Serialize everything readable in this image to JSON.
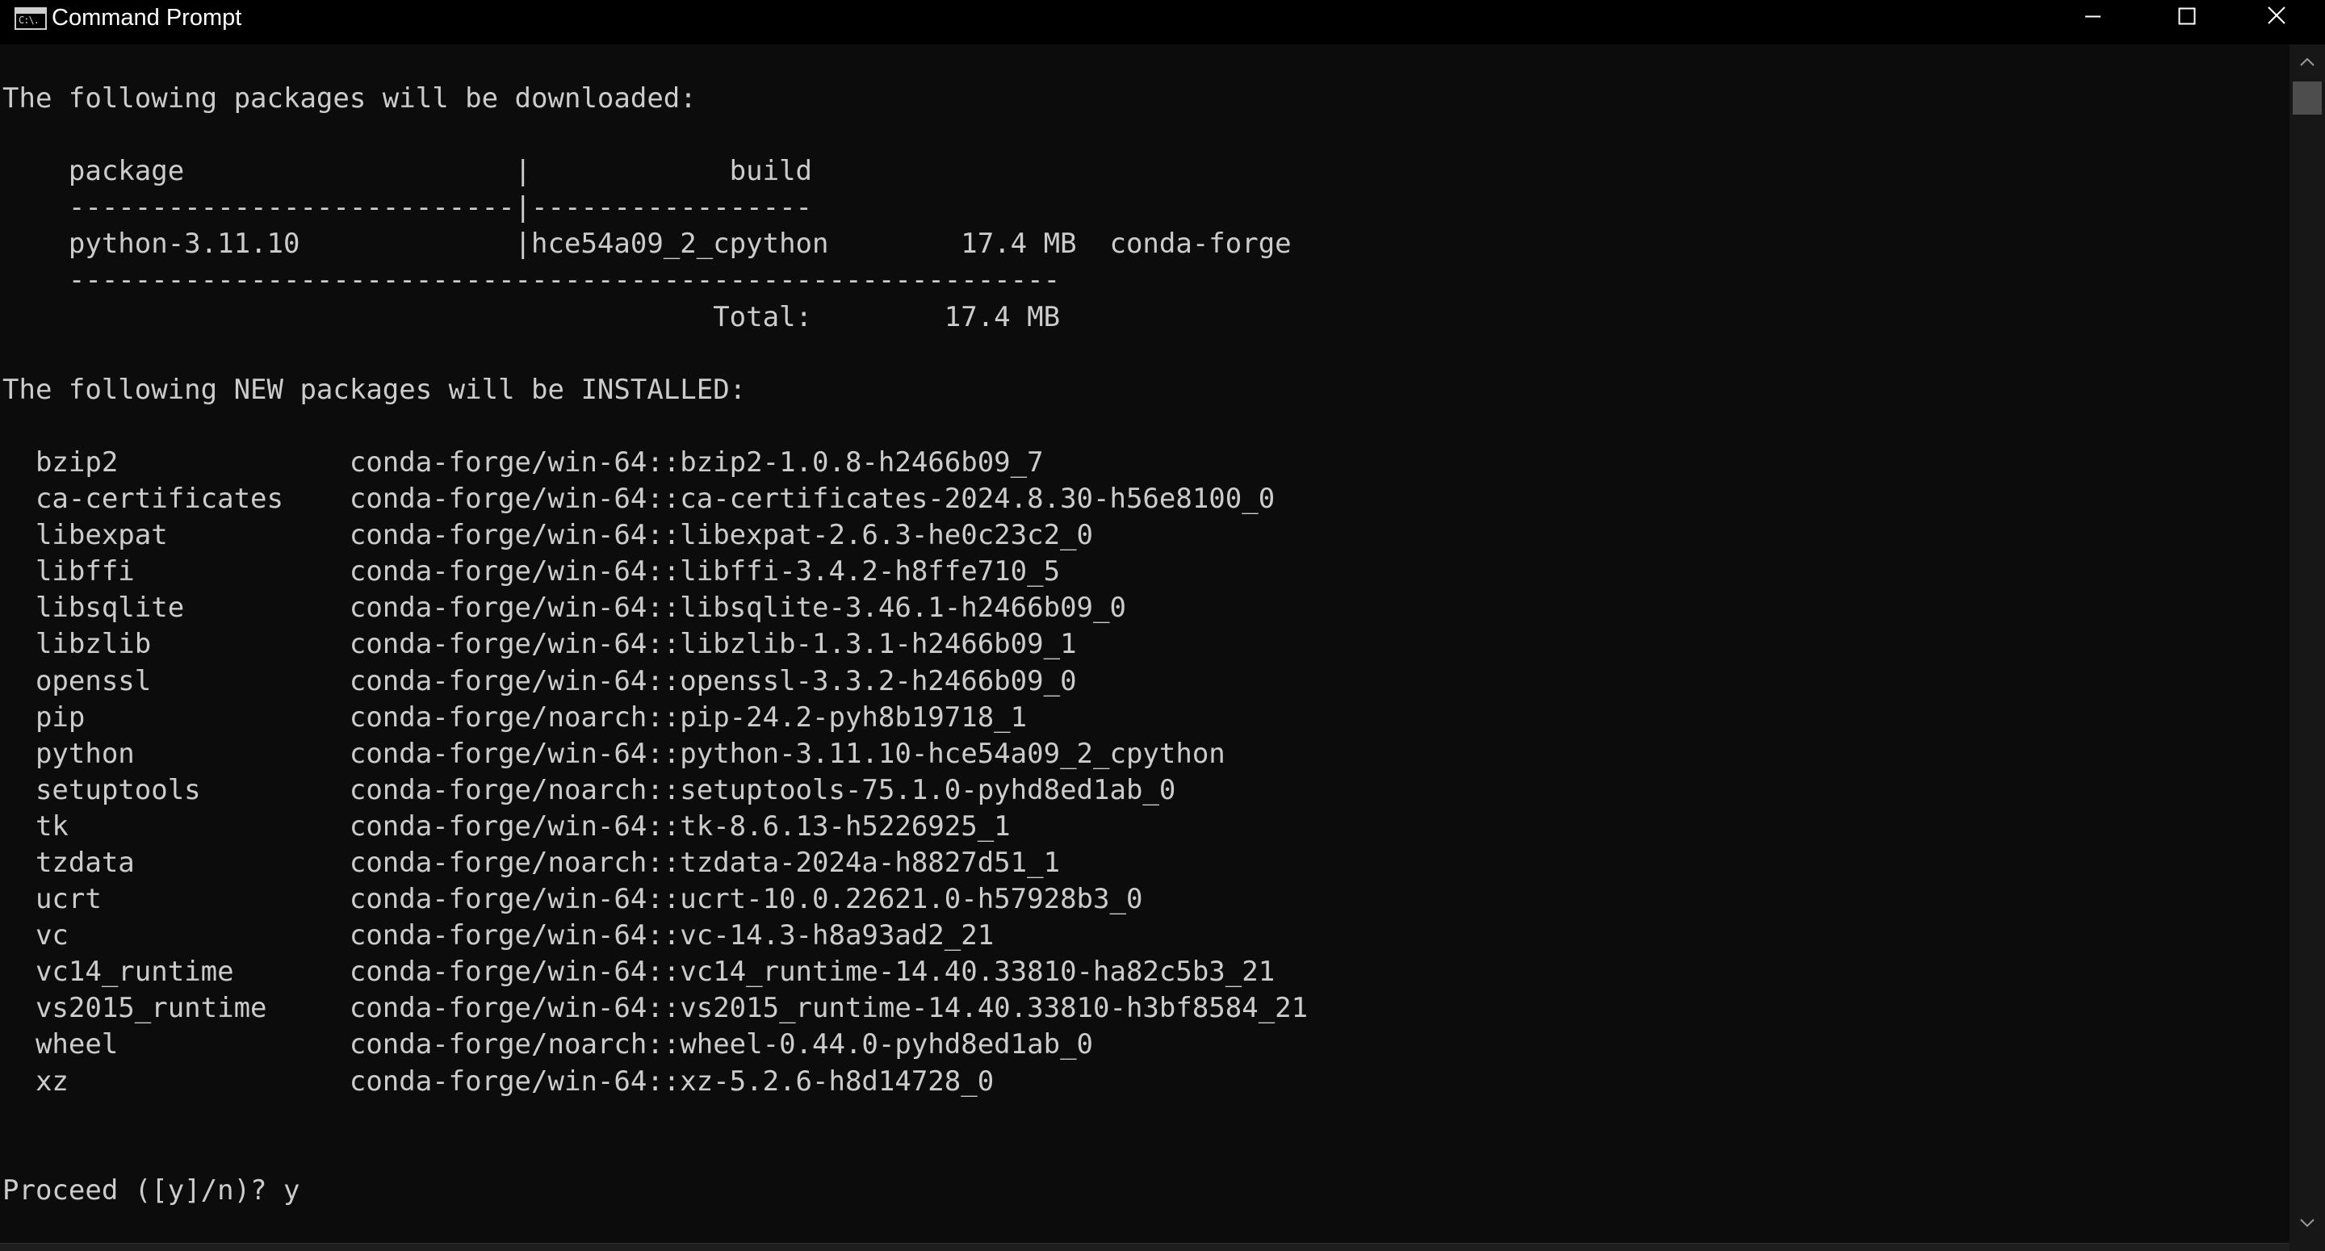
{
  "window": {
    "title": "Command Prompt",
    "icon_label": "C:\\.",
    "icon": "console-app-icon",
    "controls": {
      "minimize": "minimize-icon",
      "maximize": "maximize-icon",
      "close": "close-icon"
    }
  },
  "console": {
    "lines": [
      "The following packages will be downloaded:",
      "",
      "    package                    |            build",
      "    ---------------------------|-----------------",
      "    python-3.11.10             |hce54a09_2_cpython        17.4 MB  conda-forge",
      "    ------------------------------------------------------------",
      "                                           Total:        17.4 MB",
      "",
      "The following NEW packages will be INSTALLED:",
      "",
      "  bzip2              conda-forge/win-64::bzip2-1.0.8-h2466b09_7",
      "  ca-certificates    conda-forge/win-64::ca-certificates-2024.8.30-h56e8100_0",
      "  libexpat           conda-forge/win-64::libexpat-2.6.3-he0c23c2_0",
      "  libffi             conda-forge/win-64::libffi-3.4.2-h8ffe710_5",
      "  libsqlite          conda-forge/win-64::libsqlite-3.46.1-h2466b09_0",
      "  libzlib            conda-forge/win-64::libzlib-1.3.1-h2466b09_1",
      "  openssl            conda-forge/win-64::openssl-3.3.2-h2466b09_0",
      "  pip                conda-forge/noarch::pip-24.2-pyh8b19718_1",
      "  python             conda-forge/win-64::python-3.11.10-hce54a09_2_cpython",
      "  setuptools         conda-forge/noarch::setuptools-75.1.0-pyhd8ed1ab_0",
      "  tk                 conda-forge/win-64::tk-8.6.13-h5226925_1",
      "  tzdata             conda-forge/noarch::tzdata-2024a-h8827d51_1",
      "  ucrt               conda-forge/win-64::ucrt-10.0.22621.0-h57928b3_0",
      "  vc                 conda-forge/win-64::vc-14.3-h8a93ad2_21",
      "  vc14_runtime       conda-forge/win-64::vc14_runtime-14.40.33810-ha82c5b3_21",
      "  vs2015_runtime     conda-forge/win-64::vs2015_runtime-14.40.33810-h3bf8584_21",
      "  wheel              conda-forge/noarch::wheel-0.44.0-pyhd8ed1ab_0",
      "  xz                 conda-forge/win-64::xz-5.2.6-h8d14728_0",
      "",
      "",
      "Proceed ([y]/n)? y"
    ]
  },
  "scrollbar": {
    "up_icon": "scroll-up-arrow-icon",
    "down_icon": "scroll-down-arrow-icon",
    "position_fraction": 0.0
  },
  "colors": {
    "background": "#0c0c0c",
    "titlebar": "#000000",
    "text": "#cccccc",
    "scrollbar_track": "#171717",
    "scrollbar_thumb": "#4d4d4d"
  }
}
